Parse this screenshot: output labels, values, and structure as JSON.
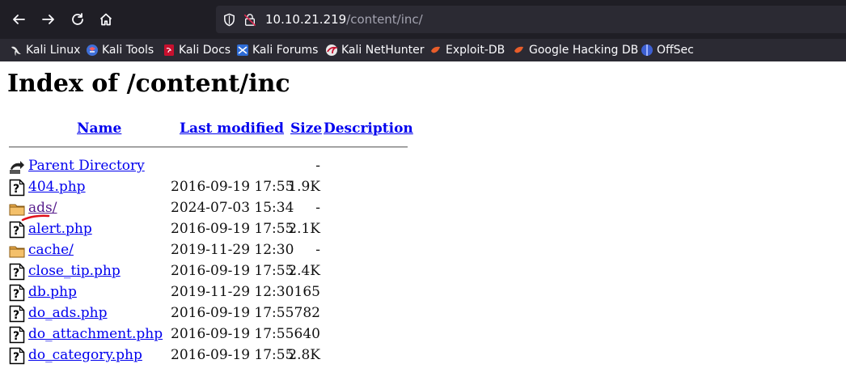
{
  "browser": {
    "url_host": "10.10.21.219",
    "url_path": "/content/inc/",
    "icons": {
      "back": "back-arrow-icon",
      "forward": "forward-arrow-icon",
      "reload": "reload-icon",
      "home": "home-icon",
      "shield": "shield-icon",
      "lock": "insecure-lock-icon"
    },
    "bookmarks": [
      {
        "label": "Kali Linux",
        "icon": "kali-dragon-icon"
      },
      {
        "label": "Kali Tools",
        "icon": "kali-tools-icon"
      },
      {
        "label": "Kali Docs",
        "icon": "kali-docs-icon"
      },
      {
        "label": "Kali Forums",
        "icon": "kali-forums-icon"
      },
      {
        "label": "Kali NetHunter",
        "icon": "nethunter-icon"
      },
      {
        "label": "Exploit-DB",
        "icon": "exploit-db-icon"
      },
      {
        "label": "Google Hacking DB",
        "icon": "ghdb-icon"
      },
      {
        "label": "OffSec",
        "icon": "offsec-icon"
      }
    ]
  },
  "page": {
    "title": "Index of /content/inc",
    "columns": {
      "name": "Name",
      "last_modified": "Last modified",
      "size": "Size",
      "description": "Description"
    },
    "rows": [
      {
        "name": "Parent Directory",
        "date": "",
        "size": "-",
        "type": "parent"
      },
      {
        "name": "404.php",
        "date": "2016-09-19 17:55",
        "size": "1.9K",
        "type": "file"
      },
      {
        "name": "ads/",
        "date": "2024-07-03 15:34",
        "size": "-",
        "type": "folder"
      },
      {
        "name": "alert.php",
        "date": "2016-09-19 17:55",
        "size": "2.1K",
        "type": "file"
      },
      {
        "name": "cache/",
        "date": "2019-11-29 12:30",
        "size": "-",
        "type": "folder"
      },
      {
        "name": "close_tip.php",
        "date": "2016-09-19 17:55",
        "size": "2.4K",
        "type": "file"
      },
      {
        "name": "db.php",
        "date": "2019-11-29 12:30",
        "size": "165",
        "type": "file"
      },
      {
        "name": "do_ads.php",
        "date": "2016-09-19 17:55",
        "size": "782",
        "type": "file"
      },
      {
        "name": "do_attachment.php",
        "date": "2016-09-19 17:55",
        "size": "640",
        "type": "file"
      },
      {
        "name": "do_category.php",
        "date": "2016-09-19 17:55",
        "size": "2.8K",
        "type": "file"
      }
    ]
  },
  "colors": {
    "link": "#0000ee",
    "visited": "#551a8b",
    "toolbar": "#1f1e25",
    "bookmarks_bar": "#2b2a33",
    "annotation": "#e0101a"
  }
}
